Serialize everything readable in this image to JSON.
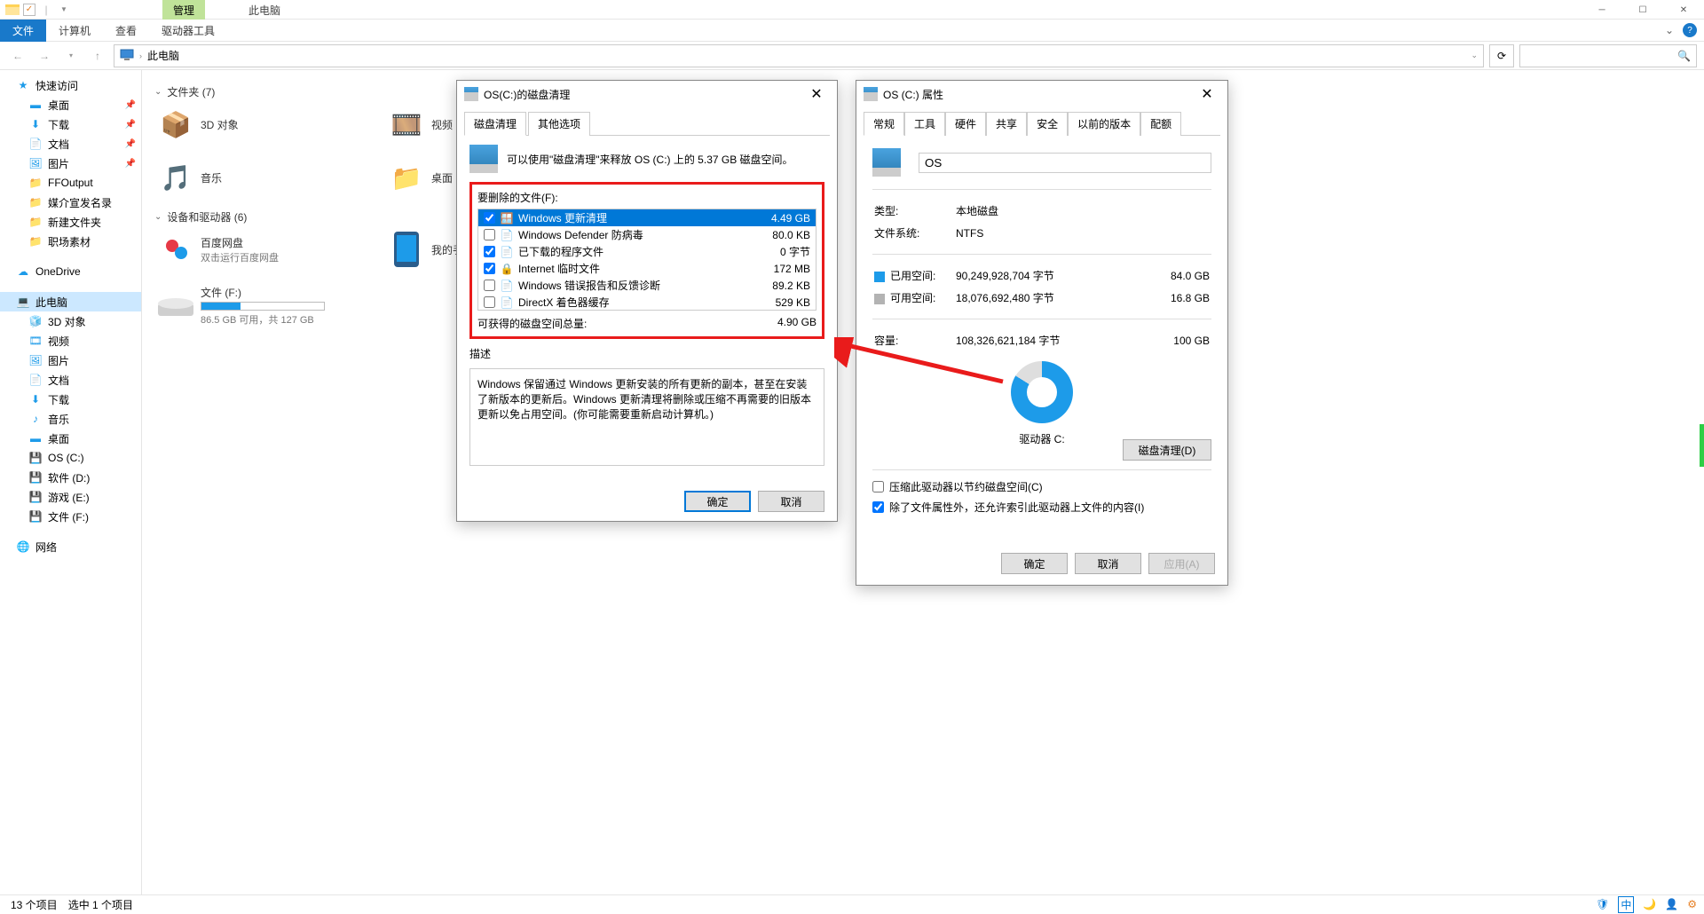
{
  "titlebar": {
    "manage": "管理",
    "location": "此电脑"
  },
  "ribbon": {
    "file": "文件",
    "computer": "计算机",
    "view": "查看",
    "drive_tools": "驱动器工具"
  },
  "nav": {
    "breadcrumb": "此电脑"
  },
  "sidebar": {
    "quick_access": "快速访问",
    "desktop": "桌面",
    "downloads": "下载",
    "documents": "文档",
    "pictures": "图片",
    "ffoutput": "FFOutput",
    "media": "媒介宣发名录",
    "newfolder": "新建文件夹",
    "workplace": "职场素材",
    "onedrive": "OneDrive",
    "thispc": "此电脑",
    "thispc_3d": "3D 对象",
    "thispc_video": "视频",
    "thispc_pictures": "图片",
    "thispc_documents": "文档",
    "thispc_downloads": "下载",
    "thispc_music": "音乐",
    "thispc_desktop": "桌面",
    "os_c": "OS (C:)",
    "soft_d": "软件 (D:)",
    "game_e": "游戏 (E:)",
    "file_f": "文件 (F:)",
    "network": "网络"
  },
  "content": {
    "folders_header": "文件夹 (7)",
    "devices_header": "设备和驱动器 (6)",
    "tile_3d": "3D 对象",
    "tile_video": "视频",
    "tile_music": "音乐",
    "tile_desktop": "桌面",
    "tile_baidu": "百度网盘",
    "tile_baidu_sub": "双击运行百度网盘",
    "tile_phone": "我的手",
    "tile_file_f": "文件 (F:)",
    "tile_file_f_sub": "86.5 GB 可用，共 127 GB"
  },
  "status": {
    "items": "13 个项目",
    "selected": "选中 1 个项目"
  },
  "cleanup": {
    "title": "OS(C:)的磁盘清理",
    "tab1": "磁盘清理",
    "tab2": "其他选项",
    "summary": "可以使用\"磁盘清理\"来释放 OS (C:) 上的 5.37 GB 磁盘空间。",
    "files_label": "要删除的文件(F):",
    "files": [
      {
        "checked": true,
        "icon": "win",
        "name": "Windows 更新清理",
        "size": "4.49 GB",
        "selected": true
      },
      {
        "checked": false,
        "icon": "file",
        "name": "Windows Defender 防病毒",
        "size": "80.0 KB"
      },
      {
        "checked": true,
        "icon": "file",
        "name": "已下载的程序文件",
        "size": "0 字节"
      },
      {
        "checked": true,
        "icon": "lock",
        "name": "Internet 临时文件",
        "size": "172 MB"
      },
      {
        "checked": false,
        "icon": "file",
        "name": "Windows 错误报告和反馈诊断",
        "size": "89.2 KB"
      },
      {
        "checked": false,
        "icon": "file",
        "name": "DirectX 着色器缓存",
        "size": "529 KB"
      }
    ],
    "total_label": "可获得的磁盘空间总量:",
    "total_value": "4.90 GB",
    "desc_label": "描述",
    "desc_text": "Windows 保留通过 Windows 更新安装的所有更新的副本，甚至在安装了新版本的更新后。Windows 更新清理将删除或压缩不再需要的旧版本更新以免占用空间。(你可能需要重新启动计算机。)",
    "ok": "确定",
    "cancel": "取消"
  },
  "props": {
    "title": "OS (C:) 属性",
    "tabs": [
      "常规",
      "工具",
      "硬件",
      "共享",
      "安全",
      "以前的版本",
      "配额"
    ],
    "name_value": "OS",
    "type_label": "类型:",
    "type_value": "本地磁盘",
    "fs_label": "文件系统:",
    "fs_value": "NTFS",
    "used_label": "已用空间:",
    "used_bytes": "90,249,928,704 字节",
    "used_gb": "84.0 GB",
    "free_label": "可用空间:",
    "free_bytes": "18,076,692,480 字节",
    "free_gb": "16.8 GB",
    "cap_label": "容量:",
    "cap_bytes": "108,326,621,184 字节",
    "cap_gb": "100 GB",
    "drive_label": "驱动器 C:",
    "cleanup_btn": "磁盘清理(D)",
    "compress": "压缩此驱动器以节约磁盘空间(C)",
    "index": "除了文件属性外，还允许索引此驱动器上文件的内容(I)",
    "ok": "确定",
    "cancel": "取消",
    "apply": "应用(A)"
  },
  "tray": {
    "ime": "中"
  }
}
